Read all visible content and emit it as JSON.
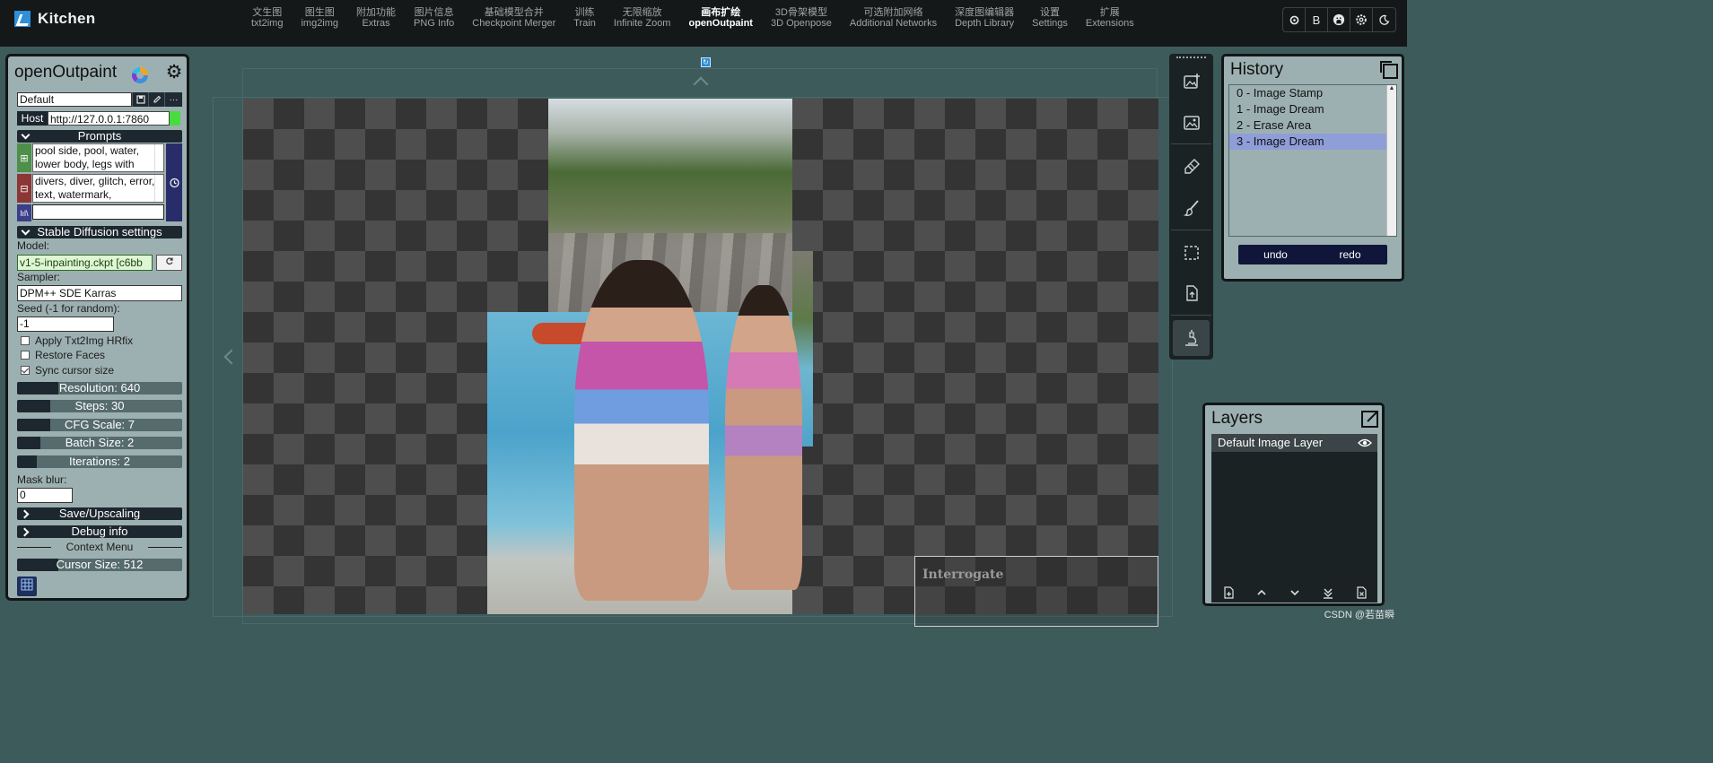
{
  "app": {
    "brand": "Kitchen"
  },
  "nav": [
    {
      "zh": "文生图",
      "en": "txt2img",
      "active": false
    },
    {
      "zh": "图生图",
      "en": "img2img",
      "active": false
    },
    {
      "zh": "附加功能",
      "en": "Extras",
      "active": false
    },
    {
      "zh": "图片信息",
      "en": "PNG Info",
      "active": false
    },
    {
      "zh": "基础模型合并",
      "en": "Checkpoint Merger",
      "active": false
    },
    {
      "zh": "训练",
      "en": "Train",
      "active": false
    },
    {
      "zh": "无限缩放",
      "en": "Infinite Zoom",
      "active": false
    },
    {
      "zh": "画布扩绘",
      "en": "openOutpaint",
      "active": true
    },
    {
      "zh": "3D骨架模型",
      "en": "3D Openpose",
      "active": false
    },
    {
      "zh": "可选附加网络",
      "en": "Additional Networks",
      "active": false
    },
    {
      "zh": "深度图编辑器",
      "en": "Depth Library",
      "active": false
    },
    {
      "zh": "设置",
      "en": "Settings",
      "active": false
    },
    {
      "zh": "扩展",
      "en": "Extensions",
      "active": false
    }
  ],
  "top_icons": [
    "settings-cog-icon",
    "b-letter-icon",
    "github-icon",
    "gear-icon",
    "moon-icon"
  ],
  "top_icon_b_text": "B",
  "left_panel": {
    "title": "openOutpaint",
    "preset_value": "Default",
    "host_label": "Host",
    "host_value": "http://127.0.0.1:7860",
    "prompts_label": "Prompts",
    "positive_prompt": "pool side, pool, water, lower body, legs with",
    "negative_prompt": "divers, diver, glitch, error, text, watermark,",
    "style_value": "",
    "sd_settings_label": "Stable Diffusion settings",
    "model_label": "Model:",
    "model_value": "v1-5-inpainting.ckpt [c6bb",
    "sampler_label": "Sampler:",
    "sampler_value": "DPM++ SDE Karras",
    "seed_label": "Seed (-1 for random):",
    "seed_value": "-1",
    "checkboxes": [
      {
        "label": "Apply Txt2Img HRfix",
        "checked": false
      },
      {
        "label": "Restore Faces",
        "checked": false
      },
      {
        "label": "Sync cursor size",
        "checked": true
      }
    ],
    "sliders": {
      "resolution": {
        "label": "Resolution: 640",
        "fraction": 0.25
      },
      "steps": {
        "label": "Steps: 30",
        "fraction": 0.2
      },
      "cfg": {
        "label": "CFG Scale: 7",
        "fraction": 0.2
      },
      "batch": {
        "label": "Batch Size: 2",
        "fraction": 0.14
      },
      "iterations": {
        "label": "Iterations: 2",
        "fraction": 0.12
      },
      "cursor": {
        "label": "Cursor Size: 512",
        "fraction": 0.25
      }
    },
    "mask_blur_label": "Mask blur:",
    "mask_blur_value": "0",
    "save_label": "Save/Upscaling",
    "debug_label": "Debug info",
    "context_menu_label": "Context Menu"
  },
  "history": {
    "title": "History",
    "items": [
      "0 - Image Stamp",
      "1 - Image Dream",
      "2 - Erase Area",
      "3 - Image Dream"
    ],
    "current_index": 3,
    "undo_label": "undo",
    "redo_label": "redo"
  },
  "layers": {
    "title": "Layers",
    "items": [
      "Default Image Layer"
    ]
  },
  "canvas": {
    "interrogate_label": "Interrogate"
  },
  "watermark": "CSDN @若苗瞬",
  "colors": {
    "accent_blue": "#2a8fd6",
    "host_ok": "#47dd3e",
    "panel_bg": "#9db0b1",
    "history_selected": "#8f9ed8"
  }
}
